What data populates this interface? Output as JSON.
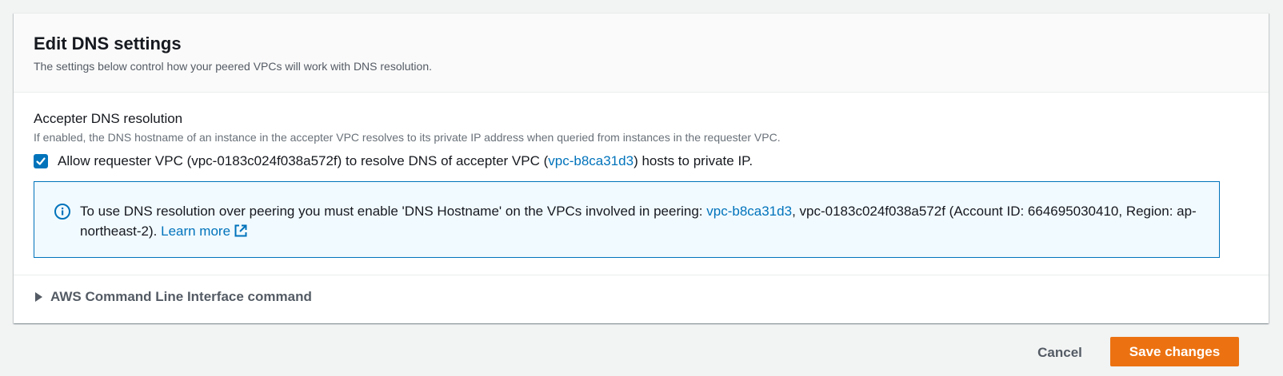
{
  "panel": {
    "title": "Edit DNS settings",
    "description": "The settings below control how your peered VPCs will work with DNS resolution."
  },
  "accepter_dns": {
    "label": "Accepter DNS resolution",
    "description": "If enabled, the DNS hostname of an instance in the accepter VPC resolves to its private IP address when queried from instances in the requester VPC.",
    "checked": true,
    "checkbox_text_before": "Allow requester VPC (vpc-0183c024f038a572f) to resolve DNS of accepter VPC (",
    "checkbox_link": "vpc-b8ca31d3",
    "checkbox_text_after": ") hosts to private IP."
  },
  "info": {
    "text_before": "To use DNS resolution over peering you must enable 'DNS Hostname' on the VPCs involved in peering: ",
    "vpc_link": "vpc-b8ca31d3",
    "text_after": ", vpc-0183c024f038a572f (Account ID: 664695030410, Region: ap-northeast-2). ",
    "learn_more": "Learn more"
  },
  "cli_section": {
    "label": "AWS Command Line Interface command"
  },
  "footer": {
    "cancel_label": "Cancel",
    "save_label": "Save changes"
  },
  "colors": {
    "link": "#0073bb",
    "primary_button": "#ec7211",
    "info_border": "#0073bb",
    "info_background": "#f1faff"
  },
  "icons": {
    "info": "info-circle-icon",
    "external": "external-link-icon",
    "checkbox": "check-icon",
    "expander": "caret-right-icon"
  }
}
